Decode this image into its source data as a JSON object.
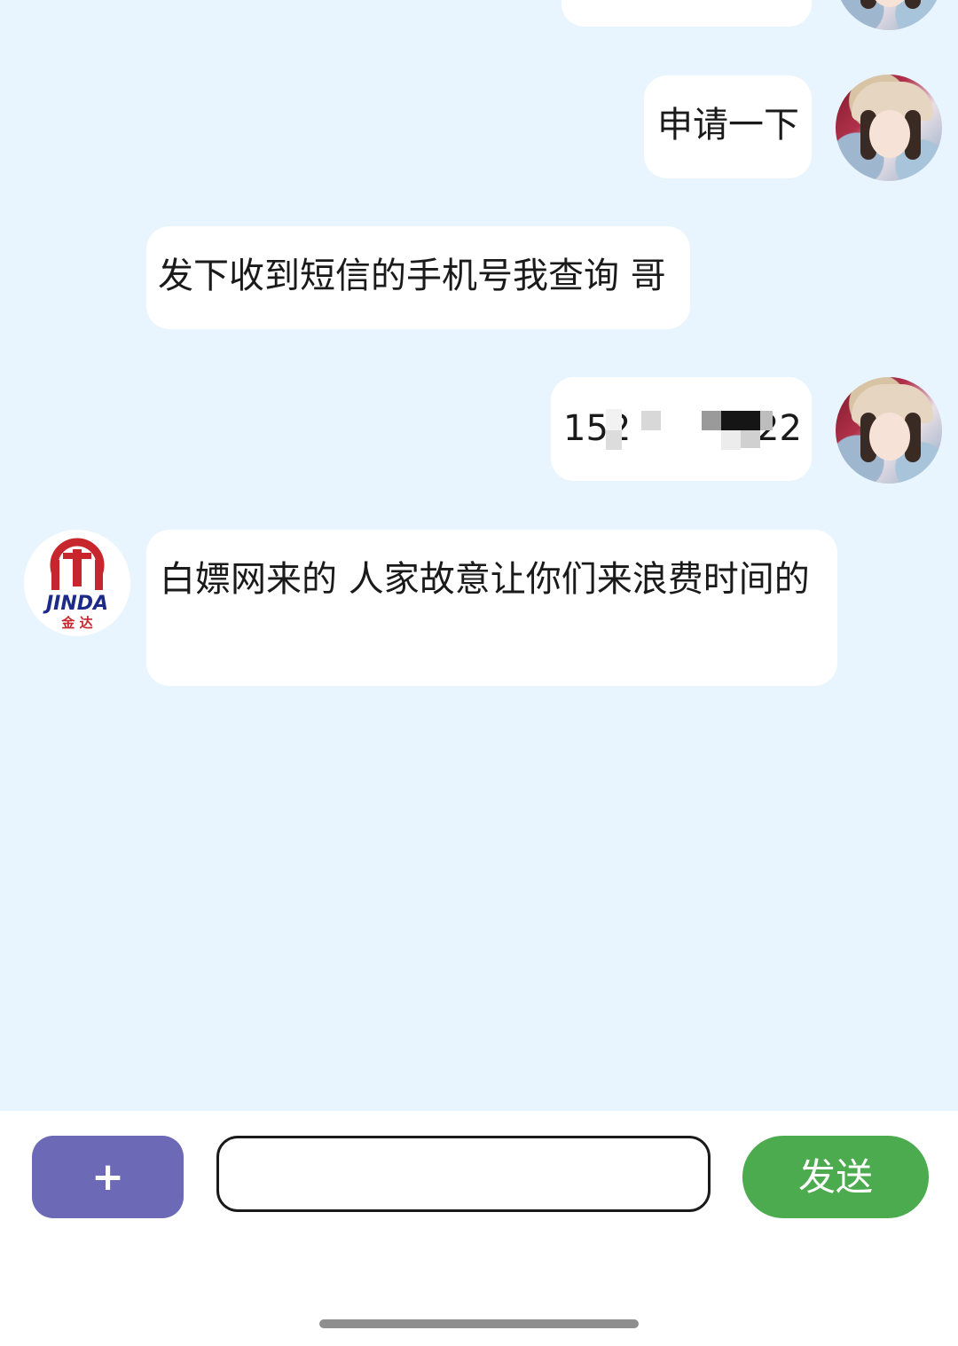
{
  "messages": [
    {
      "side": "right",
      "text": ""
    },
    {
      "side": "right",
      "text": "申请一下"
    },
    {
      "side": "left",
      "text": "发下收到短信的手机号我查询 哥"
    },
    {
      "side": "right",
      "text_prefix": "152",
      "text_suffix": "22"
    },
    {
      "side": "left",
      "text": "白嫖网来的 人家故意让你们来浪费时间的"
    }
  ],
  "logo": {
    "text_top": "JINDA",
    "text_bottom": "金 达",
    "brand_red": "#c8262d",
    "brand_blue": "#1c2a8a"
  },
  "composer": {
    "plus_label": "+",
    "input_value": "",
    "send_label": "发送"
  },
  "colors": {
    "chat_background": "#e9f5fe",
    "bubble": "#ffffff",
    "plus_button": "#6c69b6",
    "send_button": "#4caa4f"
  }
}
